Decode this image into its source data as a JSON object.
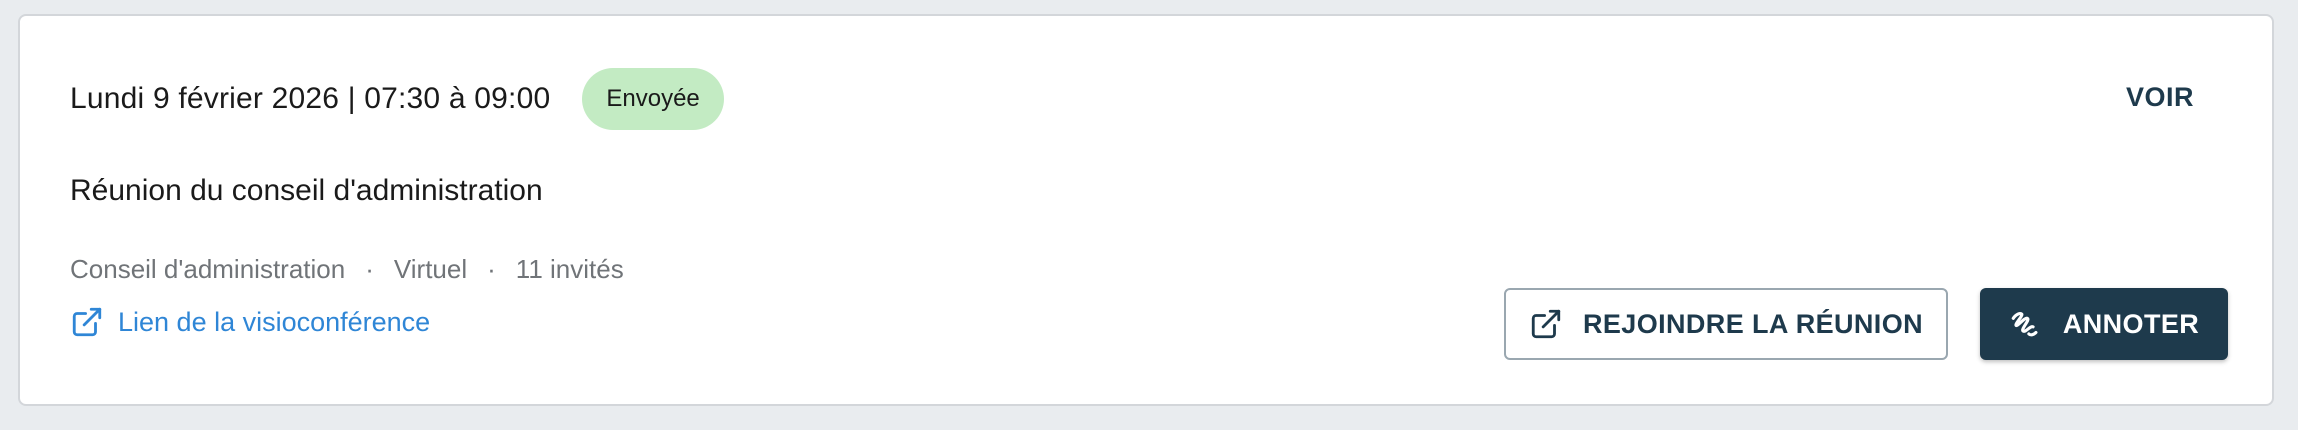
{
  "meeting": {
    "datetime": "Lundi 9 février 2026 | 07:30 à 09:00",
    "status_badge": "Envoyée",
    "view_label": "VOIR",
    "title": "Réunion du conseil d'administration",
    "meta": {
      "committee": "Conseil d'administration",
      "separator": "·",
      "location_type": "Virtuel",
      "invitees": "11 invités"
    },
    "video_link_label": "Lien de la visioconférence",
    "actions": {
      "join_label": "REJOINDRE LA RÉUNION",
      "annotate_label": "ANNOTER"
    }
  },
  "icons": {
    "video_link": "external-link-icon",
    "join": "external-link-icon",
    "annotate": "signature-icon"
  },
  "colors": {
    "badge_bg": "#c3ebc3",
    "primary": "#1e3a4c",
    "link": "#2f86d6",
    "muted_text": "#707478"
  }
}
